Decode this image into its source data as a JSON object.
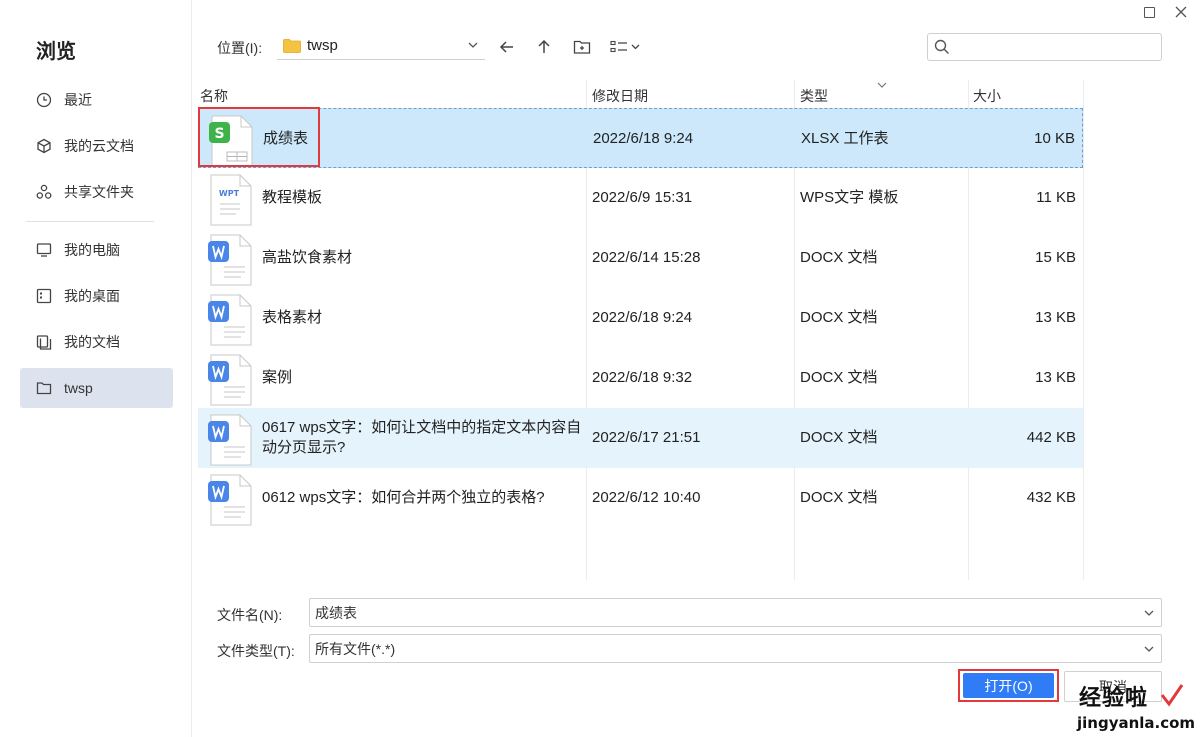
{
  "sidebar": {
    "title": "浏览",
    "items": [
      {
        "label": "最近",
        "icon": "clock-icon"
      },
      {
        "label": "我的云文档",
        "icon": "cube-icon"
      },
      {
        "label": "共享文件夹",
        "icon": "share-icon"
      },
      {
        "label": "我的电脑",
        "icon": "monitor-icon"
      },
      {
        "label": "我的桌面",
        "icon": "desktop-icon"
      },
      {
        "label": "我的文档",
        "icon": "documents-icon"
      },
      {
        "label": "twsp",
        "icon": "folder-icon"
      }
    ]
  },
  "toolbar": {
    "location_label": "位置(I):",
    "location_value": "twsp"
  },
  "search": {
    "placeholder": ""
  },
  "columns": {
    "name": "名称",
    "date": "修改日期",
    "type": "类型",
    "size": "大小"
  },
  "files": [
    {
      "name": "成绩表",
      "date": "2022/6/18 9:24",
      "type": "XLSX 工作表",
      "size": "10 KB",
      "icon": "spreadsheet-file-icon"
    },
    {
      "name": "教程模板",
      "date": "2022/6/9 15:31",
      "type": "WPS文字 模板",
      "size": "11 KB",
      "icon": "wpt-template-file-icon",
      "badge": "WPT"
    },
    {
      "name": "高盐饮食素材",
      "date": "2022/6/14 15:28",
      "type": "DOCX 文档",
      "size": "15 KB",
      "icon": "word-file-icon"
    },
    {
      "name": "表格素材",
      "date": "2022/6/18 9:24",
      "type": "DOCX 文档",
      "size": "13 KB",
      "icon": "word-file-icon"
    },
    {
      "name": "案例",
      "date": "2022/6/18 9:32",
      "type": "DOCX 文档",
      "size": "13 KB",
      "icon": "word-file-icon"
    },
    {
      "name": "0617 wps文字：如何让文档中的指定文本内容自动分页显示?",
      "date": "2022/6/17 21:51",
      "type": "DOCX 文档",
      "size": "442 KB",
      "icon": "word-file-icon"
    },
    {
      "name": "0612 wps文字：如何合并两个独立的表格?",
      "date": "2022/6/12 10:40",
      "type": "DOCX 文档",
      "size": "432 KB",
      "icon": "word-file-icon"
    }
  ],
  "form": {
    "filename_label": "文件名(N):",
    "filename_value": "成绩表",
    "filetype_label": "文件类型(T):",
    "filetype_value": "所有文件(*.*)"
  },
  "buttons": {
    "open": "打开(O)",
    "cancel": "取消"
  },
  "watermark": {
    "cn": "经验啦",
    "en": "jingyanla.com"
  },
  "colors": {
    "accent": "#2f7cf6",
    "selected_row": "#cce8fa",
    "highlight": "#e23a3a",
    "sidebar_active": "#dde3ee"
  }
}
